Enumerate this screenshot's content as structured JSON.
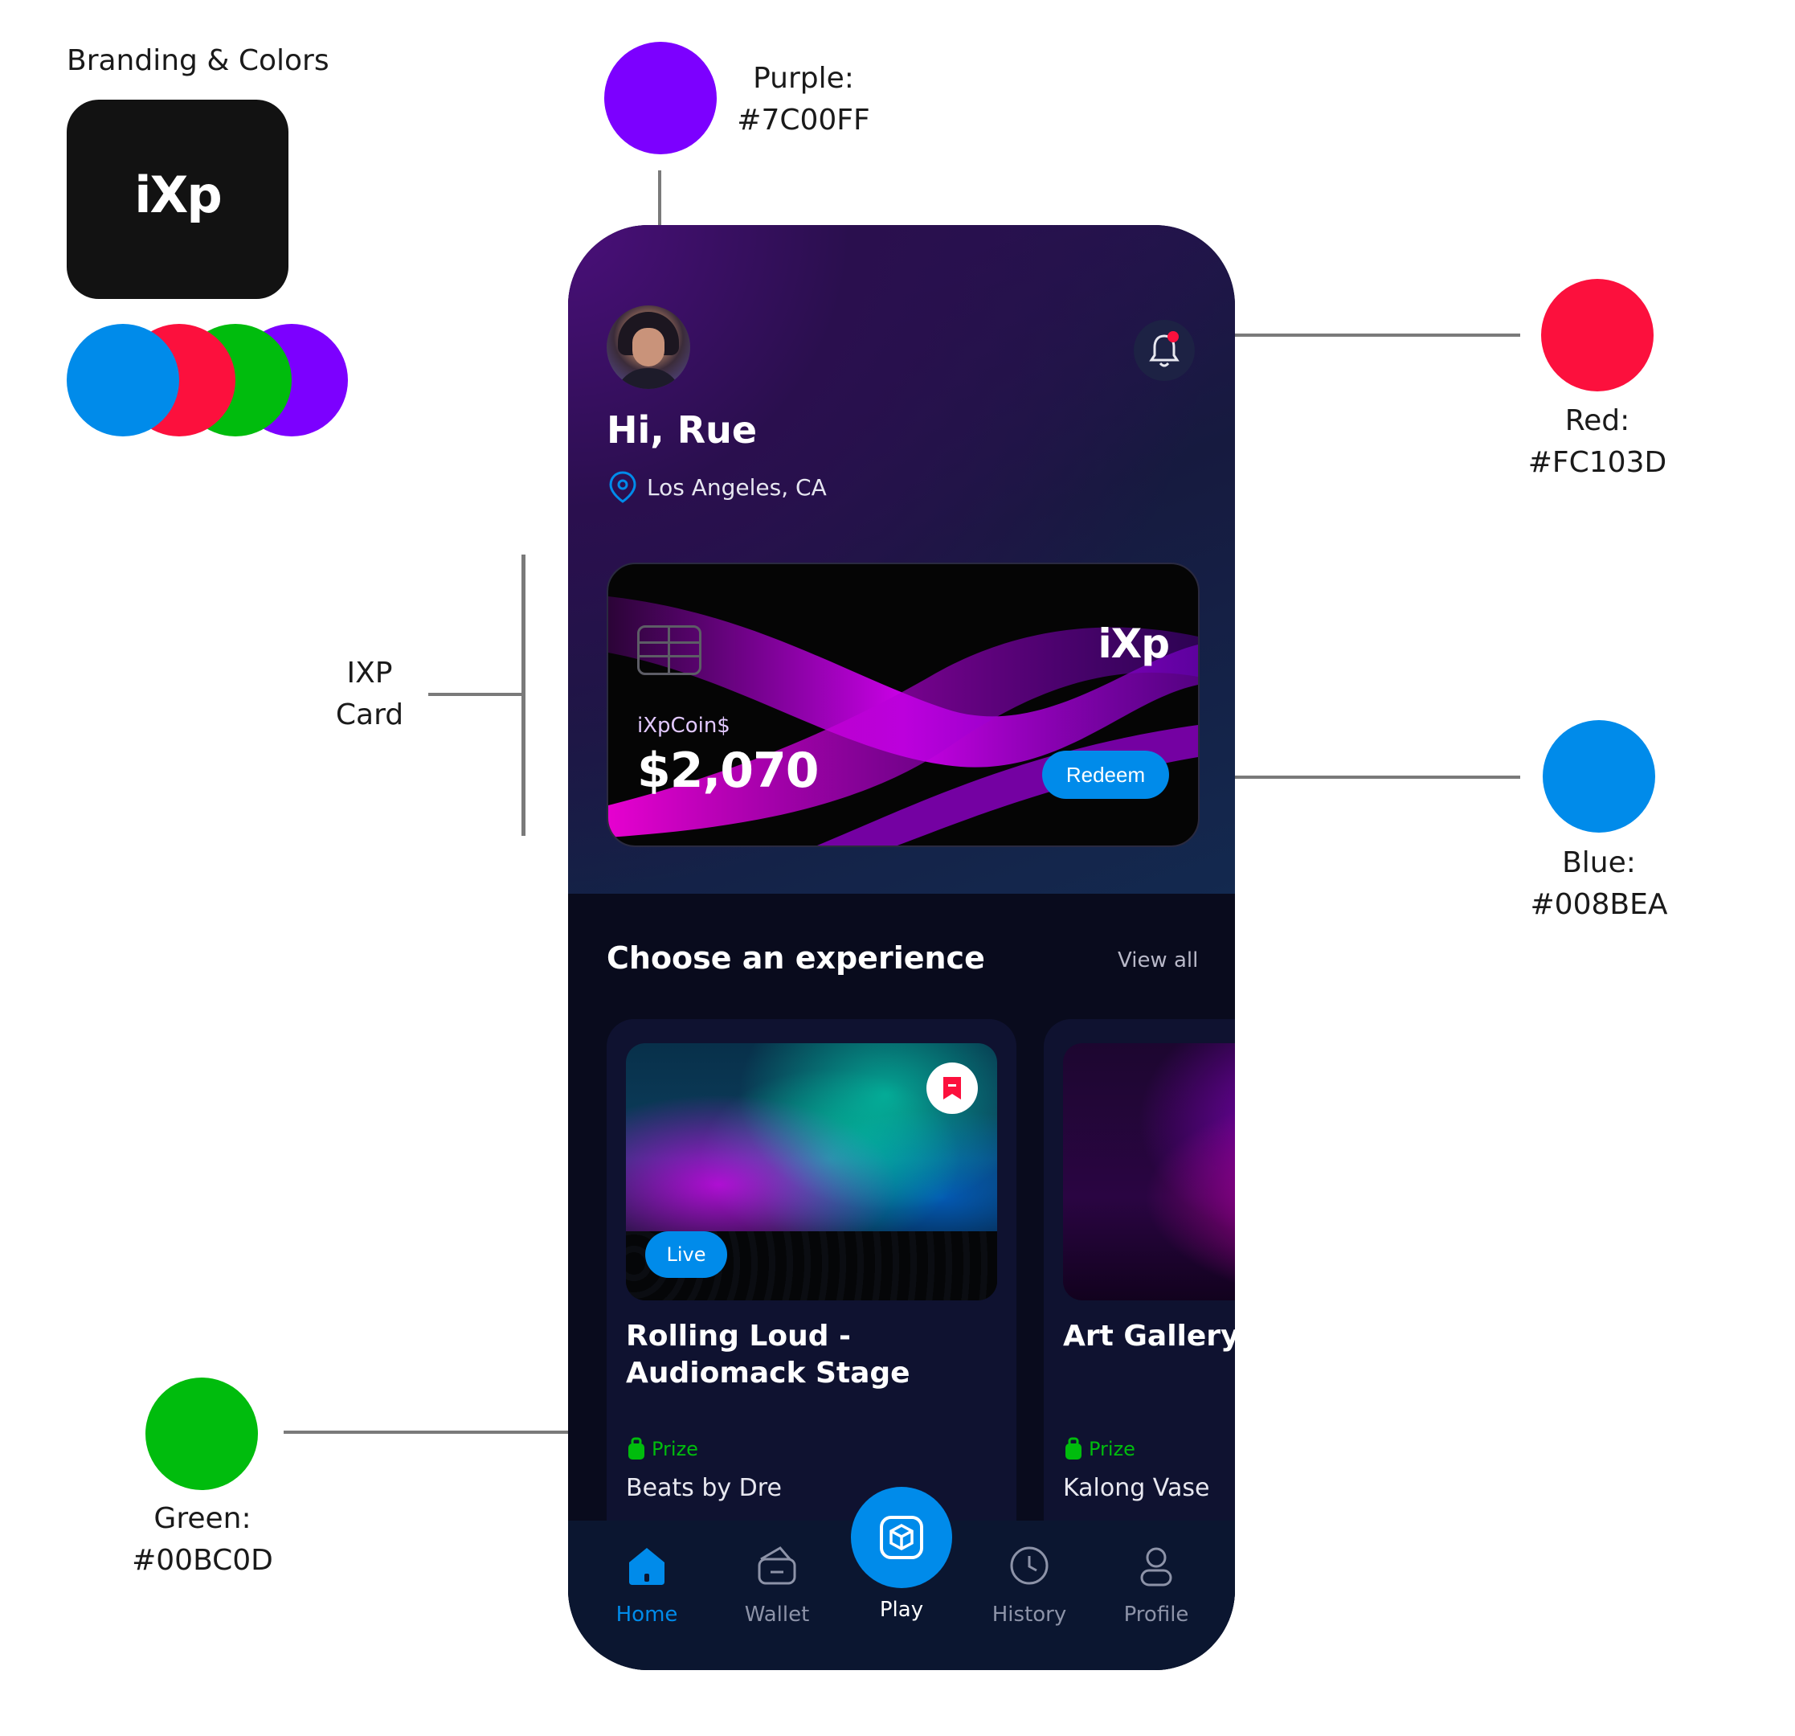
{
  "annotations": {
    "branding_title": "Branding & Colors",
    "purple_label": "Purple:",
    "purple_hex": "#7C00FF",
    "red_label": "Red:",
    "red_hex": "#FC103D",
    "blue_label": "Blue:",
    "blue_hex": "#008BEA",
    "green_label": "Green:",
    "green_hex": "#00BC0D",
    "card_label_line1": "IXP",
    "card_label_line2": "Card"
  },
  "brand": {
    "logo_text": "iXp",
    "colors": {
      "purple": "#7C00FF",
      "red": "#FC103D",
      "blue": "#008BEA",
      "green": "#00BC0D"
    }
  },
  "header": {
    "greeting": "Hi, Rue",
    "location": "Los Angeles, CA"
  },
  "card": {
    "logo_text": "iXp",
    "coin_label": "iXpCoin$",
    "balance": "$2,070",
    "redeem_label": "Redeem"
  },
  "experiences": {
    "section_title": "Choose an experience",
    "view_all": "View all",
    "items": [
      {
        "title": "Rolling Loud - Audiomack Stage",
        "badge": "Live",
        "prize_label": "Prize",
        "prize": "Beats by Dre"
      },
      {
        "title": "Art Gallery",
        "prize_label": "Prize",
        "prize": "Kalong Vase"
      }
    ]
  },
  "tabbar": {
    "items": [
      {
        "label": "Home",
        "icon": "home-icon",
        "active": true
      },
      {
        "label": "Wallet",
        "icon": "wallet-icon"
      },
      {
        "label": "Play",
        "icon": "cube-icon"
      },
      {
        "label": "History",
        "icon": "clock-icon"
      },
      {
        "label": "Profile",
        "icon": "user-icon"
      }
    ]
  }
}
